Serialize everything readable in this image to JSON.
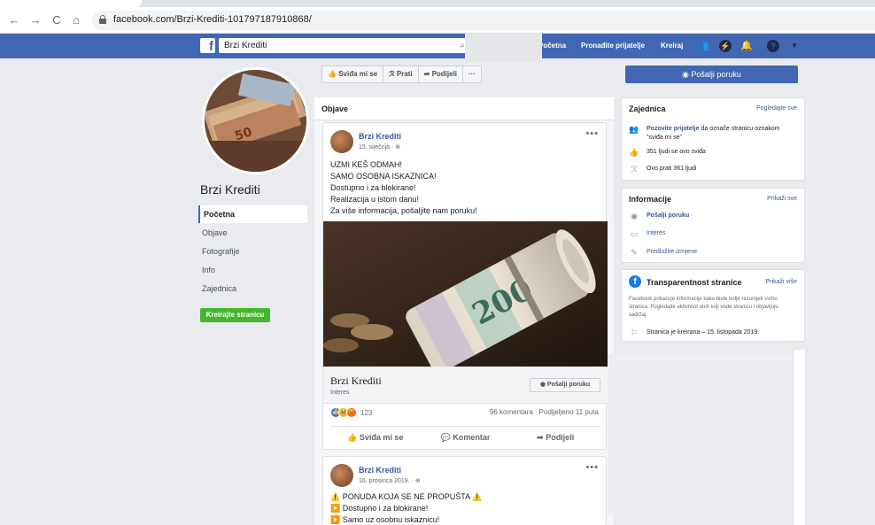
{
  "browser": {
    "url": "facebook.com/Brzi-Krediti-101797187910868/",
    "back_icon": "←",
    "forward_icon": "→",
    "reload_icon": "C",
    "home_icon": "⌂"
  },
  "fb_header": {
    "logo": "f",
    "search_value": "Brzi Krediti",
    "nav": [
      "Početna",
      "Pronađite prijatelje",
      "Kreiraj"
    ]
  },
  "left": {
    "page_name": "Brzi Krediti",
    "nav": [
      "Početna",
      "Objave",
      "Fotografije",
      "Info",
      "Zajednica"
    ],
    "create_page": "Kreirajte stranicu"
  },
  "actions": {
    "like": "Sviđa mi se",
    "follow": "Prati",
    "share": "Podijeli",
    "more": "···",
    "send_message": "Pošalji poruku"
  },
  "feed": {
    "header": "Objave",
    "post1": {
      "author": "Brzi Krediti",
      "date": "15. siječnja · ⊕",
      "lines": [
        "UZMI KEŠ ODMAH!",
        "SAMO OSOBNA ISKAZNICA!",
        "Dostupno i za blokirane!",
        "Realizacija u istom danu!",
        "Za više informacija, pošaljite nam poruku!"
      ],
      "link_title": "Brzi Krediti",
      "link_sub": "Interes",
      "link_button": "Pošalji poruku",
      "reactions_count": "123",
      "comments": "96 komentara",
      "shares": "Podijeljeno 11 puta",
      "actions": [
        "Sviđa mi se",
        "Komentar",
        "Podijeli"
      ]
    },
    "post2": {
      "author": "Brzi Krediti",
      "date": "16. prosinca 2019. · ⊕",
      "lines": [
        "⚠️ PONUDA KOJA SE NE PROPUŠTA ⚠️",
        "▶️ Dostupno i za blokirane!",
        "▶️ Samo uz osobnu iskaznicu!"
      ]
    }
  },
  "right": {
    "community": {
      "title": "Zajednica",
      "link": "Pogledajte sve",
      "invite_link": "Pozovite prijatelje",
      "invite_rest": " da označe stranicu oznakom \"sviđa mi se\"",
      "likes": "351 ljudi se ovo sviđa",
      "follows": "Ovo prati 361 ljudi"
    },
    "info": {
      "title": "Informacije",
      "link": "Prikaži sve",
      "send": "Pošalji poruku",
      "category": "Interes",
      "suggest": "Predložite izmjene"
    },
    "transparency": {
      "title": "Transparentnost stranice",
      "link": "Prikaži više",
      "text": "Facebook prikazuje informacije kako biste bolje razumjeli svrhu stranica. Pogledajte aktivnost onih koji vode stranicu i objavljuju sadržaj.",
      "created": "Stranica je kreirana – 15. listopada 2019."
    }
  },
  "colors": {
    "fb_blue": "#4267b2",
    "link": "#385898",
    "green": "#42b72a"
  }
}
